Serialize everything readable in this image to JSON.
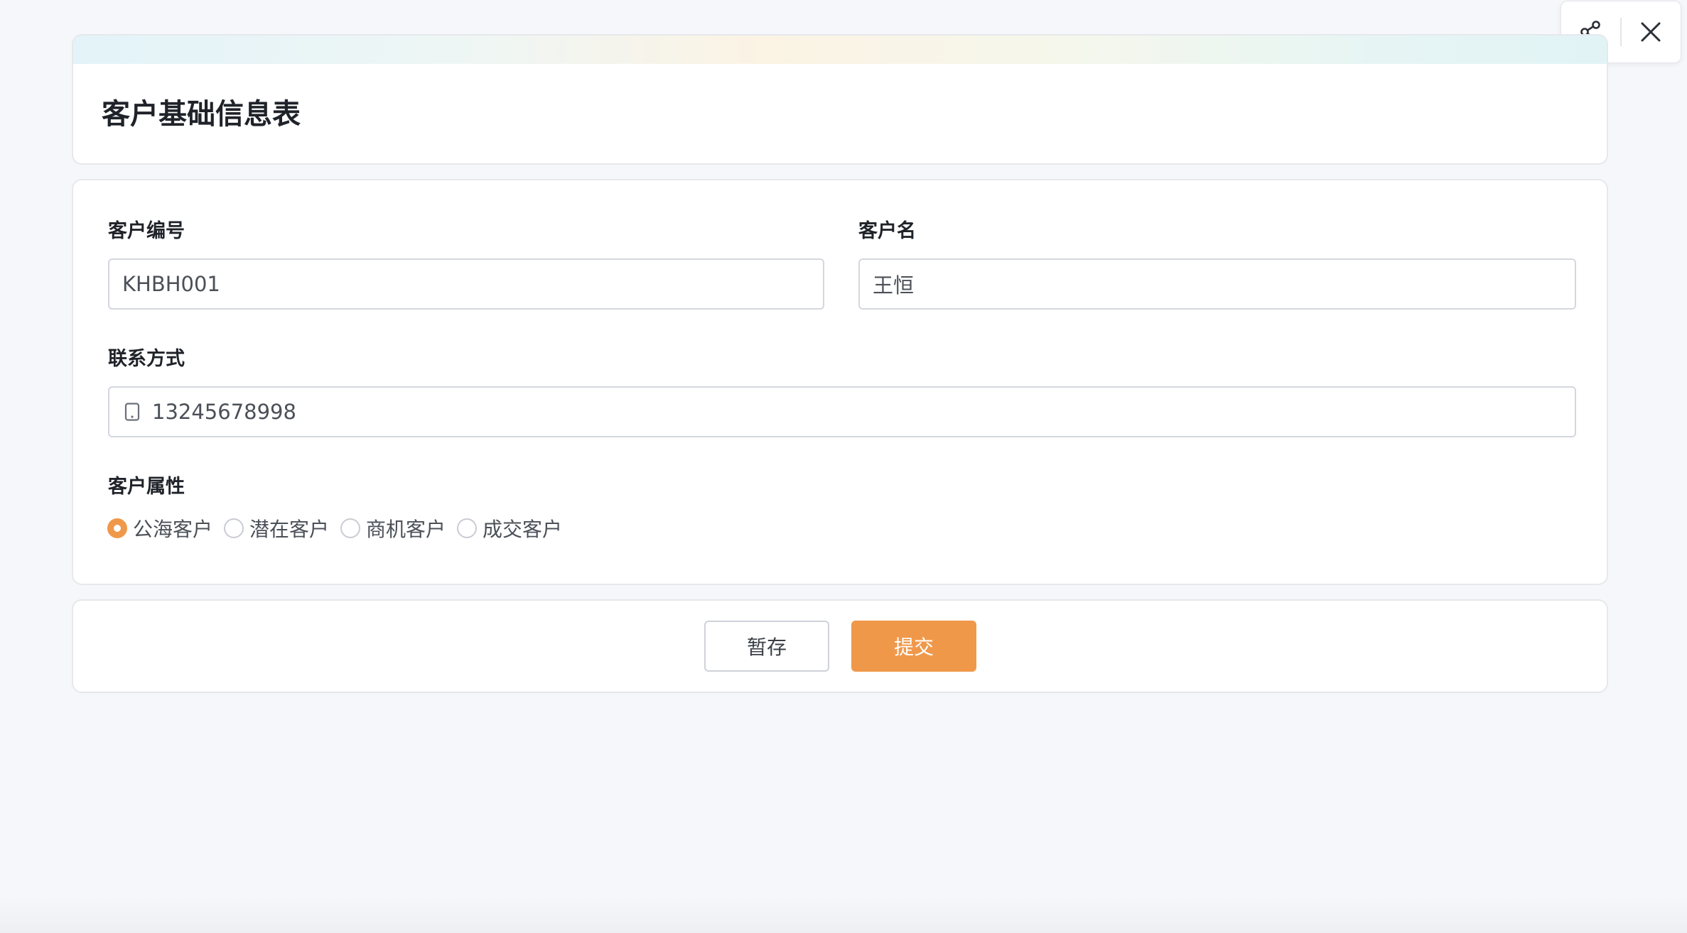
{
  "toolbar": {
    "share_icon": "share-icon",
    "close_icon": "close-icon"
  },
  "header": {
    "title": "客户基础信息表"
  },
  "form": {
    "customer_no": {
      "label": "客户编号",
      "value": "KHBH001"
    },
    "customer_name": {
      "label": "客户名",
      "value": "王恒"
    },
    "contact": {
      "label": "联系方式",
      "value": "13245678998",
      "icon": "mobile-phone-icon"
    },
    "attribute": {
      "label": "客户属性",
      "selected": "公海客户",
      "options": [
        "公海客户",
        "潜在客户",
        "商机客户",
        "成交客户"
      ]
    }
  },
  "actions": {
    "draft_label": "暂存",
    "submit_label": "提交"
  },
  "colors": {
    "accent": "#f0984a",
    "border": "#d4d7de",
    "background": "#f6f7fa"
  }
}
